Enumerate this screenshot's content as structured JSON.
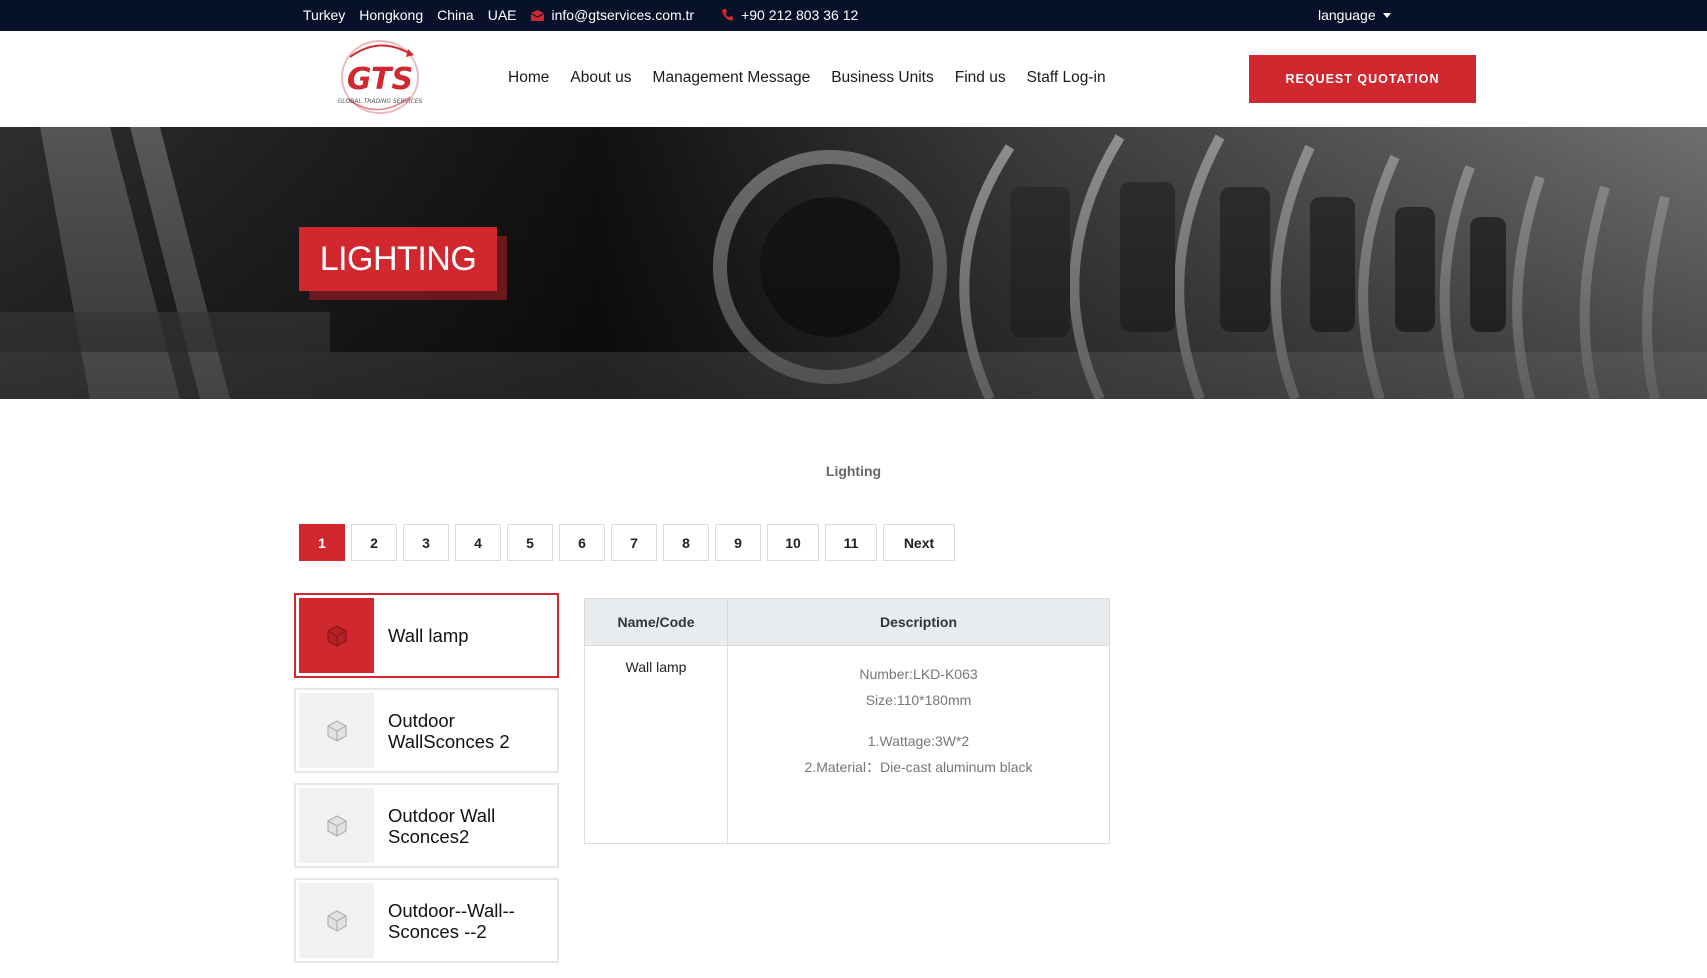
{
  "topbar": {
    "locations": [
      "Turkey",
      "Hongkong",
      "China",
      "UAE"
    ],
    "email": "info@gtservices.com.tr",
    "phone": "+90 212 803 36 12",
    "language": "language",
    "icons": {
      "email": "envelope-icon",
      "phone": "phone-icon"
    }
  },
  "header": {
    "logo_text": "GTS",
    "logo_subtext": "GLOBAL TRADING SERVICES",
    "nav": [
      "Home",
      "About us",
      "Management Message",
      "Business Units",
      "Find us",
      "Staff Log-in"
    ],
    "cta": "REQUEST QUOTATION"
  },
  "hero": {
    "title": "LIGHTING"
  },
  "breadcrumb": "Lighting",
  "pagination": {
    "pages": [
      "1",
      "2",
      "3",
      "4",
      "5",
      "6",
      "7",
      "8",
      "9",
      "10",
      "11"
    ],
    "next": "Next",
    "active": "1"
  },
  "products": [
    {
      "name": "Wall lamp",
      "icon": "cube-icon",
      "active": true
    },
    {
      "name": "Outdoor WallSconces 2",
      "icon": "cube-icon",
      "active": false
    },
    {
      "name": "Outdoor Wall Sconces2",
      "icon": "cube-icon",
      "active": false
    },
    {
      "name": "Outdoor--Wall--Sconces --2",
      "icon": "cube-icon",
      "active": false
    }
  ],
  "detail": {
    "headers": {
      "name": "Name/Code",
      "description": "Description"
    },
    "name": "Wall lamp",
    "desc_lines": [
      "Number:LKD-K063",
      "Size:110*180mm"
    ],
    "spec_lines": [
      "1.Wattage:3W*2",
      "2.Material：Die-cast aluminum black"
    ]
  },
  "colors": {
    "accent": "#d0282e",
    "topbar": "#07122a"
  }
}
